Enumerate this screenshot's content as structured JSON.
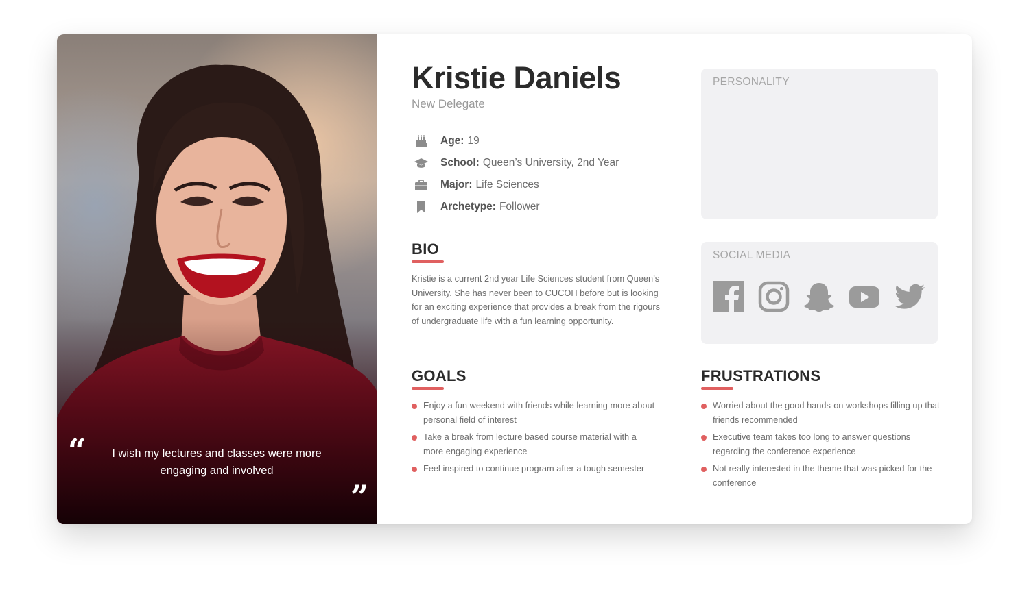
{
  "persona": {
    "name": "Kristie Daniels",
    "role": "New Delegate",
    "quote": "I wish my lectures and classes were more engaging and involved",
    "quote_open": "“",
    "quote_close": "”"
  },
  "facts": [
    {
      "icon": "birthday-cake-icon",
      "label": "Age:",
      "value": "19"
    },
    {
      "icon": "graduation-cap-icon",
      "label": "School:",
      "value": "Queen’s University, 2nd Year"
    },
    {
      "icon": "briefcase-icon",
      "label": "Major:",
      "value": "Life Sciences"
    },
    {
      "icon": "bookmark-icon",
      "label": "Archetype:",
      "value": "Follower"
    }
  ],
  "bio": {
    "title": "BIO",
    "text": "Kristie is a current 2nd year Life Sciences student from Queen’s University. She has never been to CUCOH before but is looking for an exciting experience that provides a break from the rigours of undergraduate life with a fun learning opportunity."
  },
  "goals": {
    "title": "GOALS",
    "items": [
      "Enjoy a fun weekend with friends while learning more about personal field of interest",
      "Take a break from lecture based course material with a more engaging experience",
      "Feel inspired to continue program after a tough semester"
    ]
  },
  "frustrations": {
    "title": "FRUSTRATIONS",
    "items": [
      "Worried about the good hands-on workshops filling up that friends recommended",
      "Executive team takes too long to answer questions regarding the conference experience",
      "Not really interested in the theme that was picked for the conference"
    ]
  },
  "personality": {
    "title": "PERSONALITY"
  },
  "social_media": {
    "title": "SOCIAL MEDIA",
    "icons": [
      "facebook-icon",
      "instagram-icon",
      "snapchat-icon",
      "youtube-icon",
      "twitter-icon"
    ]
  },
  "colors": {
    "accent": "#e06060",
    "heading": "#2b2b2b",
    "body_text": "#6d6d6d",
    "muted": "#9a9a9a",
    "panel": "#f1f1f3",
    "icon": "#9b9b9b"
  }
}
